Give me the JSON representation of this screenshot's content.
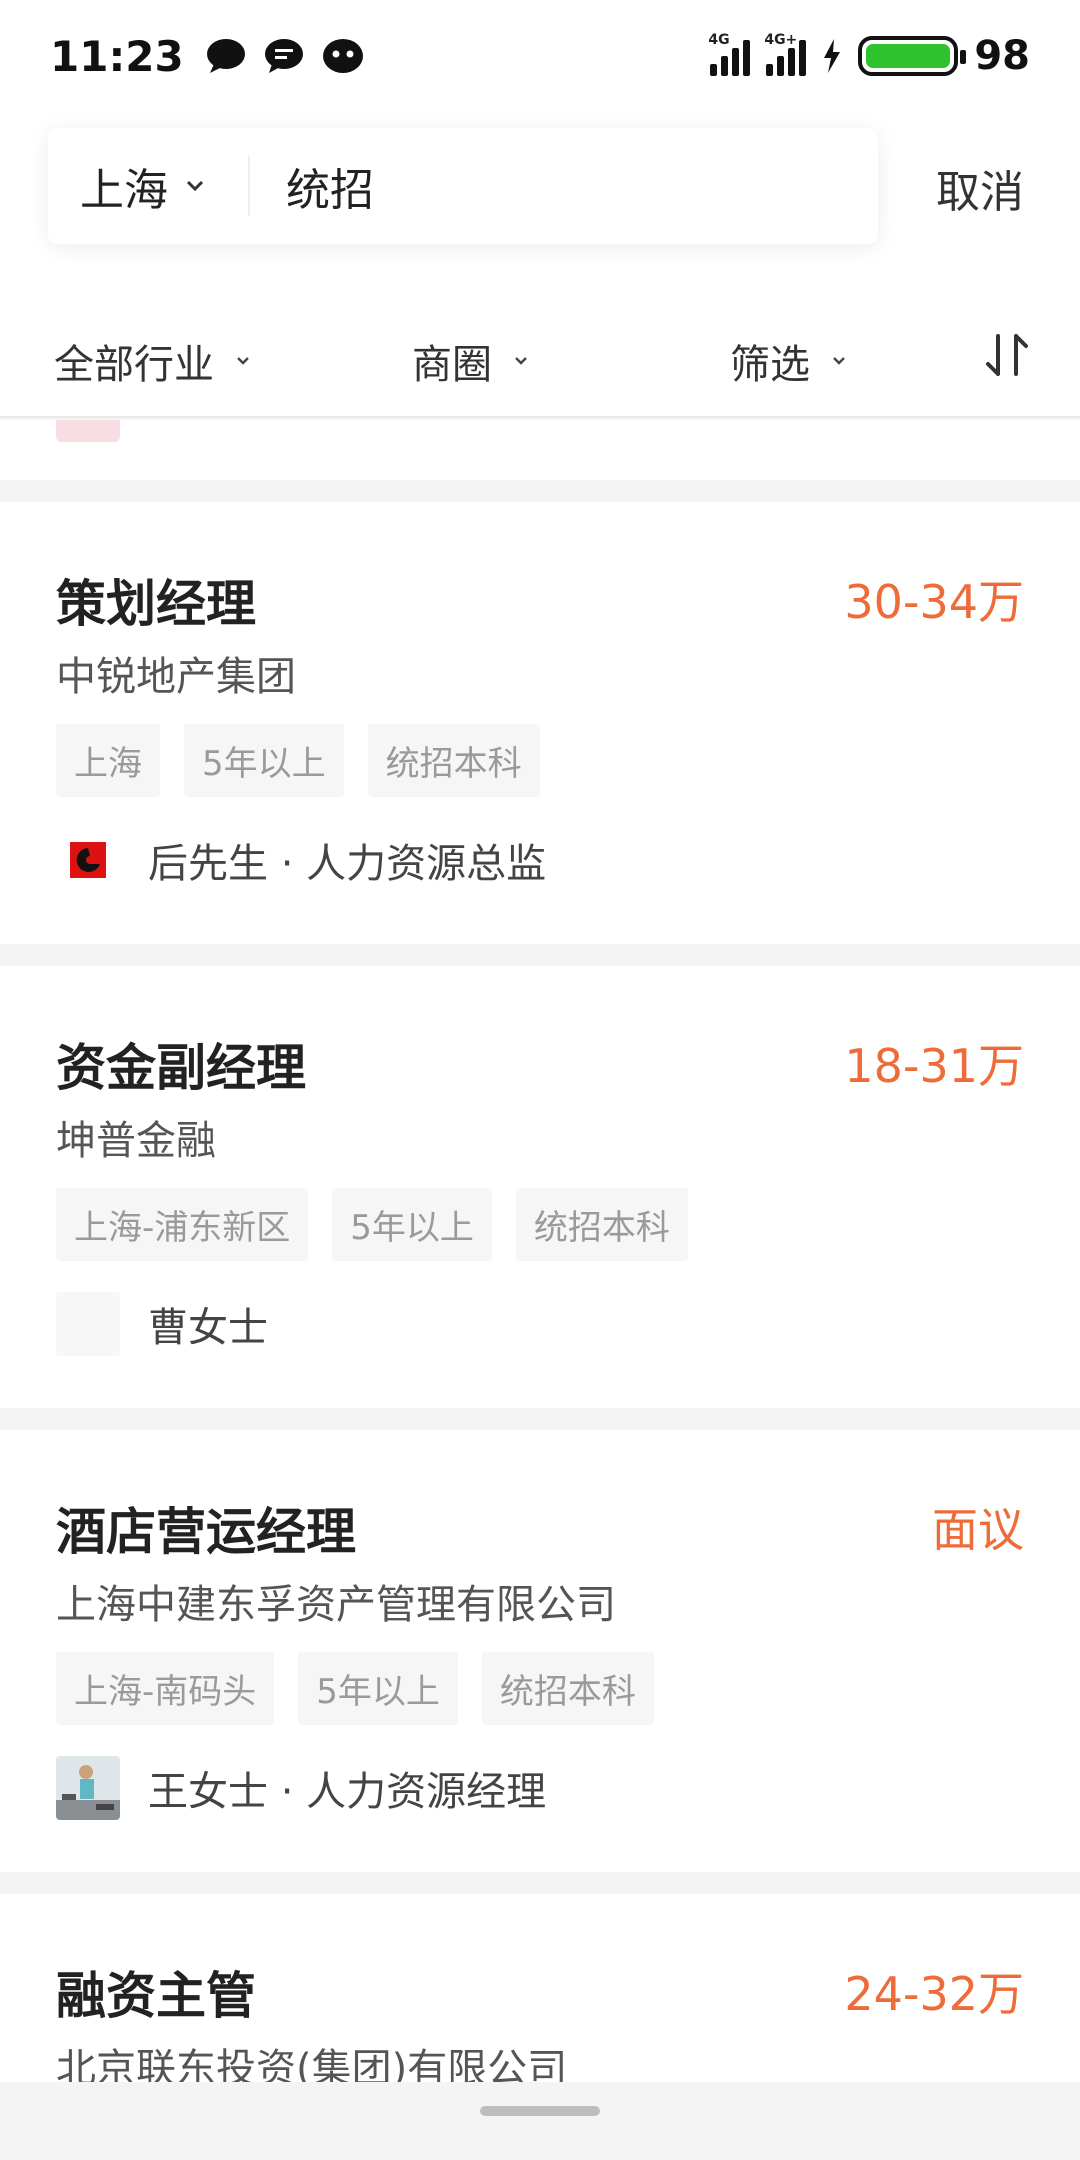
{
  "status_bar": {
    "time": "11:23",
    "notification_icons": [
      "message-icon",
      "chat-icon",
      "app-icon"
    ],
    "signal_labels": [
      "4G",
      "4G+"
    ],
    "battery_level": "98",
    "battery_color": "#2ec22e"
  },
  "search": {
    "city": "上海",
    "query": "统招",
    "cancel_label": "取消"
  },
  "filters": {
    "industry": "全部行业",
    "district": "商圈",
    "filter": "筛选",
    "sort_icon": "sort-icon"
  },
  "jobs": [
    {
      "title": "策划经理",
      "salary": "30-34万",
      "company": "中锐地产集团",
      "tags": [
        "上海",
        "5年以上",
        "统招本科"
      ],
      "recruiter": "后先生 · 人力资源总监"
    },
    {
      "title": "资金副经理",
      "salary": "18-31万",
      "company": "坤普金融",
      "tags": [
        "上海-浦东新区",
        "5年以上",
        "统招本科"
      ],
      "recruiter": "曹女士"
    },
    {
      "title": "酒店营运经理",
      "salary": "面议",
      "company": "上海中建东孚资产管理有限公司",
      "tags": [
        "上海-南码头",
        "5年以上",
        "统招本科"
      ],
      "recruiter": "王女士 · 人力资源经理"
    },
    {
      "title": "融资主管",
      "salary": "24-32万",
      "company": "北京联东投资(集团)有限公司"
    }
  ],
  "colors": {
    "salary": "#ee6b3a",
    "tag_bg": "#f6f6f6",
    "tag_text": "#9a9a9a"
  }
}
